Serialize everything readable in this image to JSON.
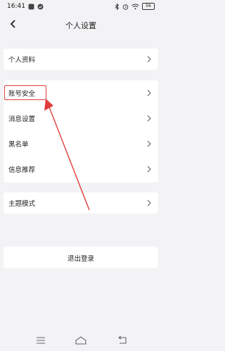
{
  "status": {
    "time": "16:41",
    "battery": "56"
  },
  "header": {
    "title": "个人设置"
  },
  "menu": {
    "profile": "个人资料",
    "account_security": "账号安全",
    "message_settings": "消息设置",
    "blacklist": "黑名单",
    "recommend": "信息推荐",
    "theme": "主题模式"
  },
  "logout_label": "退出登录",
  "colors": {
    "highlight": "#e03c3c",
    "background": "#f3f3f5"
  },
  "icons": [
    "back-arrow-icon",
    "chevron-right-icon",
    "menu-icon",
    "home-icon",
    "return-icon"
  ]
}
